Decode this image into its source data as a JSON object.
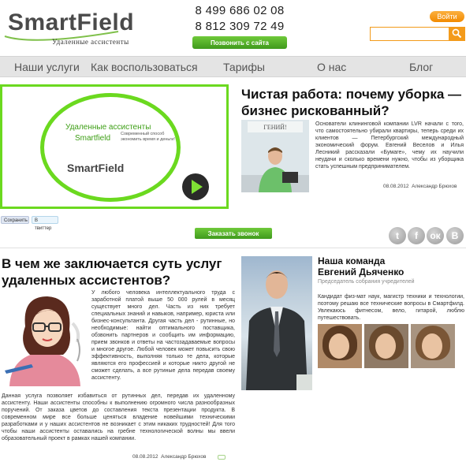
{
  "header": {
    "logo_main": "SmartField",
    "logo_sub": "Удаленные ассистенты",
    "phone1": "8 499 686 02 08",
    "phone2": "8 812 309 72 49",
    "callback_label": "Позвонить с сайта",
    "enter_label": "Войти",
    "search_placeholder": ""
  },
  "nav": {
    "items": [
      {
        "label": "Наши услуги"
      },
      {
        "label": "Как воспользоваться"
      },
      {
        "label": "Тарифы"
      },
      {
        "label": "О нас"
      },
      {
        "label": "Блог"
      }
    ]
  },
  "slide": {
    "title": "Удаленные ассистенты",
    "brand": "Smartfield",
    "note": "Современный способ экономить время и деньги!",
    "logo": "SmartField"
  },
  "share": {
    "save": "Сохранить",
    "tweet": "В твиттер"
  },
  "article1": {
    "title": "Чистая работа: почему уборка — бизнес рискованный?",
    "text": "Основатели клининговой компании LVR начали с того, что самостоятельно убирали квартиры, теперь среди их клиентов — Петербургский международный экономический форум. Евгений Веселов и Илья Лесникий рассказали «Бумаге», чему их научили неудачи и сколько времени нужно, чтобы из уборщика стать успешным предпринимателем.",
    "date": "08.08.2012",
    "author": "Александр Брюхов",
    "poster_text": "ГЕНИЙ!"
  },
  "order_label": "Заказать звонок",
  "social": {
    "icons": [
      "twitter-icon",
      "facebook-icon",
      "odnoklassniki-icon",
      "vkontakte-icon"
    ]
  },
  "article2": {
    "title": "В чем же заключается суть услуг удаленных ассистентов?",
    "text1": "У любого человека интеллектуального труда с заработной платой выше 50 000 рулей в месяц существует много дел. Часть из них требует специальных знаний и навыков, например, юриста или бизнес-консультанта. Другая часть дел - рутинные, но необходимые: найти оптимального поставщика, обзвонить партнеров и сообщить им информацию, прием звонков и ответы на частозадаваемые вопросы и многое другое. Любой человек может повысить свою эффективность, выполняя только те дела, которые являются его профессией и которые никто другой не сможет сделать, а все рутиные дела передав своему ассистенту.",
    "text2": "Данная услуга позволяет избавиться от рутинных дел, передав их удаленному ассистенту. Наши ассистенты способны к выполнению огромного числа разнообразных поручений. От заказа цветов до составления текста презентации продукта. В современном мире все больше ценяться владение новейшими техническими разработками и у наших ассистентов не возникает с этим никаких трудностей! Для того чтобы наши ассистенты оставались на гребне технологической волны мы ввели образовательный проект в рамках нашей компании.",
    "date": "08.08.2012",
    "author": "Александр Брюхов"
  },
  "team": {
    "title_line1": "Наша команда",
    "title_line2": "Евгений Дьяченко",
    "role": "Председатель собрания учредителей",
    "text": "Кандидат физ-мат наук, магистр техники и технологии, поэтому решаю все технические вопросы в Смартфилд. Увлекаюсь фитнесом, вело, гитарой, люблю путешествовать.",
    "photo_label": "ДЬЯЧЕНКО"
  },
  "colors": {
    "green": "#6bd91f",
    "orange": "#f39a1a",
    "nav_bg": "#e4e4e4"
  }
}
